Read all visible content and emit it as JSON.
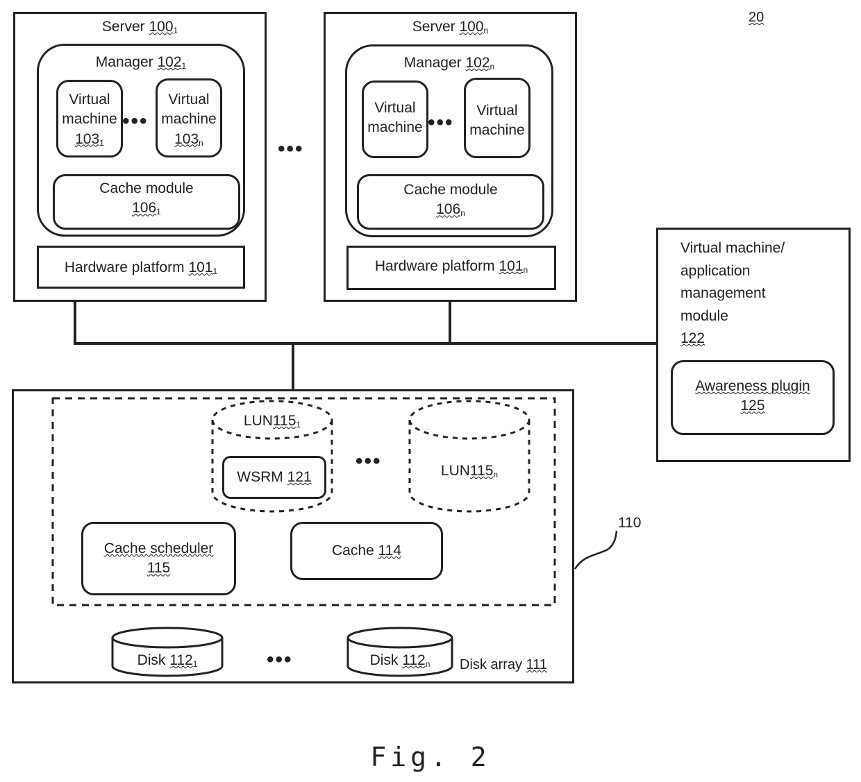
{
  "figure_ref": "20",
  "caption": "Fig. 2",
  "ellipsis": "•••",
  "servers": [
    {
      "label": "Server",
      "ref": "100",
      "ref_sub": "1",
      "manager": {
        "label": "Manager",
        "ref": "102",
        "ref_sub": "1"
      },
      "vms": [
        {
          "line1": "Virtual",
          "line2": "machine",
          "ref": "103",
          "ref_sub": "1"
        },
        {
          "line1": "Virtual",
          "line2": "machine",
          "ref": "103",
          "ref_sub": "n"
        }
      ],
      "cache_module": {
        "label": "Cache module",
        "ref": "106",
        "ref_sub": "1"
      },
      "hardware": {
        "label": "Hardware platform",
        "ref": "101",
        "ref_sub": "1"
      }
    },
    {
      "label": "Server",
      "ref": "100",
      "ref_sub": "n",
      "manager": {
        "label": "Manager",
        "ref": "102",
        "ref_sub": "n"
      },
      "vms": [
        {
          "line1": "Virtual",
          "line2": "machine"
        },
        {
          "line1": "Virtual",
          "line2": "machine"
        }
      ],
      "cache_module": {
        "label": "Cache module",
        "ref": "106",
        "ref_sub": "n"
      },
      "hardware": {
        "label": "Hardware platform",
        "ref": "101",
        "ref_sub": "n"
      }
    }
  ],
  "vm_app_mgmt": {
    "lines": [
      "Virtual machine/",
      "application",
      "management",
      "module"
    ],
    "ref": "122",
    "plugin": {
      "label": "Awareness plugin",
      "ref": "125"
    }
  },
  "storage": {
    "callout_ref": "110",
    "lun_1": {
      "label": "LUN",
      "ref": "115",
      "ref_sub": "1"
    },
    "lun_n": {
      "label": "LUN",
      "ref": "115",
      "ref_sub": "n"
    },
    "wsrm": {
      "label": "WSRM",
      "ref": "121"
    },
    "cache_scheduler": {
      "label": "Cache scheduler",
      "ref": "115"
    },
    "cache": {
      "label": "Cache",
      "ref": "114"
    },
    "disk_1": {
      "label": "Disk",
      "ref": "112",
      "ref_sub": "1"
    },
    "disk_n": {
      "label": "Disk",
      "ref": "112",
      "ref_sub": "n"
    },
    "disk_array": {
      "label": "Disk array",
      "ref": "111"
    }
  }
}
